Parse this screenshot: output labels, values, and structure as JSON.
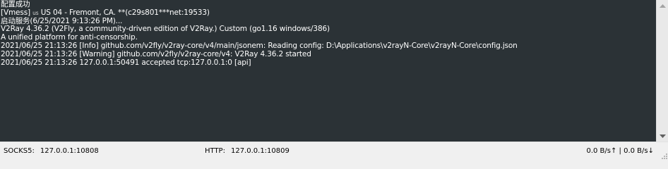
{
  "log": {
    "lines": [
      {
        "text": "配置成功"
      },
      {
        "prefix": "[Vmess] ",
        "flag": "us",
        "text": " US 04 - Fremont, CA. **(c29s801***net:19533)"
      },
      {
        "text": "启动服务(6/25/2021 9:13:26 PM)..."
      },
      {
        "text": "V2Ray 4.36.2 (V2Fly, a community-driven edition of V2Ray.) Custom (go1.16 windows/386)"
      },
      {
        "text": "A unified platform for anti-censorship."
      },
      {
        "text": "2021/06/25 21:13:26 [Info] github.com/v2fly/v2ray-core/v4/main/jsonem: Reading config: D:\\Applications\\v2rayN-Core\\v2rayN-Core\\config.json"
      },
      {
        "text": "2021/06/25 21:13:26 [Warning] github.com/v2fly/v2ray-core/v4: V2Ray 4.36.2 started"
      },
      {
        "text": "2021/06/25 21:13:26 127.0.0.1:50491 accepted tcp:127.0.0.1:0 [api]"
      }
    ]
  },
  "status": {
    "socks_label": "SOCKS5:",
    "socks_value": "127.0.0.1:10808",
    "http_label": "HTTP:",
    "http_value": "127.0.0.1:10809",
    "speed": "0.0 B/s↑ | 0.0 B/s↓"
  },
  "icons": {
    "scroll_up": "scroll-up-arrow-icon",
    "scroll_down": "scroll-down-arrow-icon",
    "grip": "resize-grip-icon"
  },
  "colors": {
    "log_background": "#2b3236",
    "log_text": "#ffffff",
    "statusbar_background": "#f0f0f0"
  }
}
